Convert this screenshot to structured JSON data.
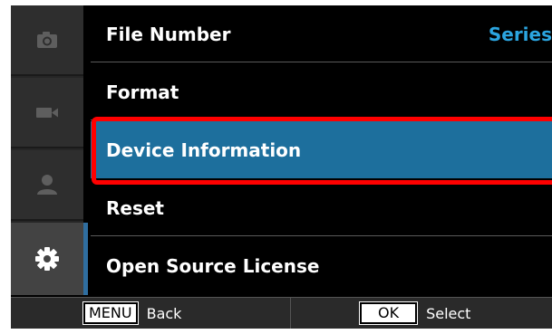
{
  "sidebar": {
    "tabs": [
      {
        "icon": "camera-icon",
        "active": false
      },
      {
        "icon": "video-camera-icon",
        "active": false
      },
      {
        "icon": "person-icon",
        "active": false
      },
      {
        "icon": "gear-icon",
        "active": true
      }
    ]
  },
  "menu": {
    "items": [
      {
        "label": "File Number",
        "value": "Series"
      },
      {
        "label": "Format"
      },
      {
        "label": "Device Information"
      },
      {
        "label": "Reset"
      },
      {
        "label": "Open Source License"
      }
    ],
    "selected_index": 2
  },
  "footer": {
    "back_key": "MENU",
    "back_label": "Back",
    "select_key": "OK",
    "select_label": "Select"
  },
  "colors": {
    "selection": "#1d6f9d",
    "value_text": "#2ba5e0",
    "annotation_box": "#ff0000"
  }
}
